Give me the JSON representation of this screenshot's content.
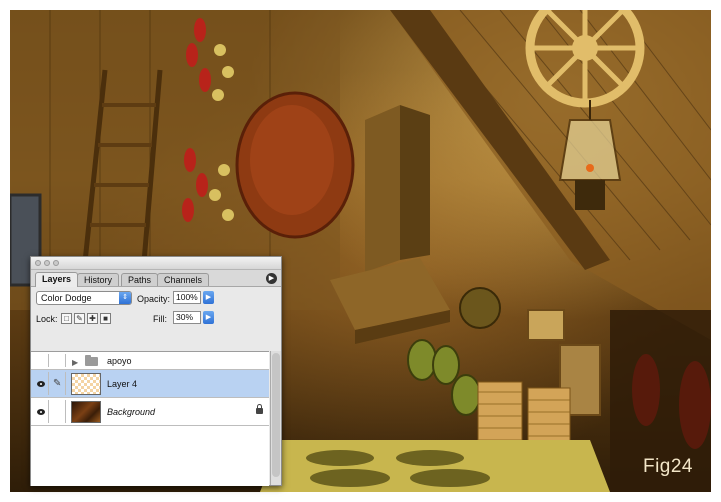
{
  "figure": {
    "label": "Fig24"
  },
  "palette": {
    "tabs": [
      {
        "label": "Layers",
        "active": true
      },
      {
        "label": "History",
        "active": false
      },
      {
        "label": "Paths",
        "active": false
      },
      {
        "label": "Channels",
        "active": false
      }
    ],
    "blend_mode": "Color Dodge",
    "opacity_label": "Opacity:",
    "opacity_value": "100%",
    "lock_label": "Lock:",
    "fill_label": "Fill:",
    "fill_value": "30%",
    "layers": [
      {
        "name": "apoyo",
        "type": "group",
        "visible": false,
        "selected": false,
        "locked": false
      },
      {
        "name": "Layer 4",
        "type": "layer",
        "visible": true,
        "selected": true,
        "locked": false
      },
      {
        "name": "Background",
        "type": "layer",
        "visible": true,
        "selected": false,
        "locked": true
      }
    ]
  },
  "icons": {
    "menu": "flyout-menu-icon",
    "stepper": "chevron-right-icon",
    "dropdown": "dropdown-arrow-icon",
    "eye": "eye-icon",
    "brush": "brush-icon",
    "lock": "lock-icon",
    "folder": "folder-icon"
  },
  "colors": {
    "selection": "#b9d2f2",
    "accent_blue": "#2f72d6",
    "scene_warm": "#7a531c"
  }
}
